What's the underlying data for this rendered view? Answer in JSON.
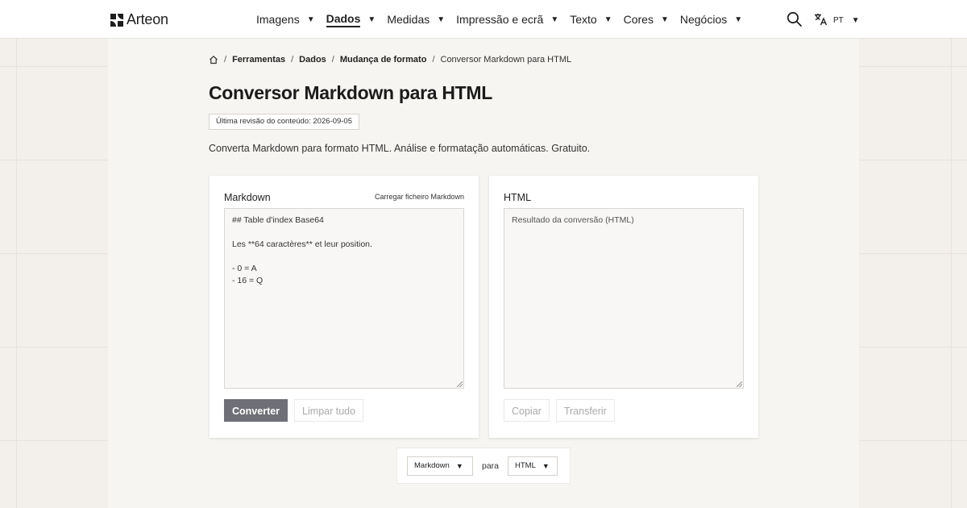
{
  "brand": {
    "name": "Arteon"
  },
  "nav": {
    "items": [
      {
        "label": "Imagens",
        "caret": "▼"
      },
      {
        "label": "Dados",
        "caret": "▼"
      },
      {
        "label": "Medidas",
        "caret": "▼"
      },
      {
        "label": "Impressão e ecrã",
        "caret": "▼"
      },
      {
        "label": "Texto",
        "caret": "▼"
      },
      {
        "label": "Cores",
        "caret": "▼"
      },
      {
        "label": "Negócios",
        "caret": "▼"
      }
    ],
    "active": "Dados",
    "language": {
      "code": "PT",
      "caret": "▼"
    }
  },
  "breadcrumb": {
    "items": [
      "Ferramentas",
      "Dados",
      "Mudança de formato"
    ],
    "current": "Conversor Markdown para HTML",
    "sep": "/"
  },
  "page": {
    "title": "Conversor Markdown para HTML",
    "review": "Última revisão do conteúdo: 2026-09-05",
    "description": "Converta Markdown para formato HTML. Análise e formatação automáticas. Gratuito."
  },
  "input_panel": {
    "label": "Markdown",
    "upload": "Carregar ficheiro Markdown",
    "value": "## Table d'index Base64\n\nLes **64 caractères** et leur position.\n\n- 0 = A\n- 16 = Q",
    "convert": "Converter",
    "clear": "Limpar tudo"
  },
  "output_panel": {
    "label": "HTML",
    "placeholder": "Resultado da conversão (HTML)",
    "copy": "Copiar",
    "download": "Transferir"
  },
  "format": {
    "from": "Markdown",
    "connector": "para",
    "to": "HTML",
    "caret": "▼"
  }
}
